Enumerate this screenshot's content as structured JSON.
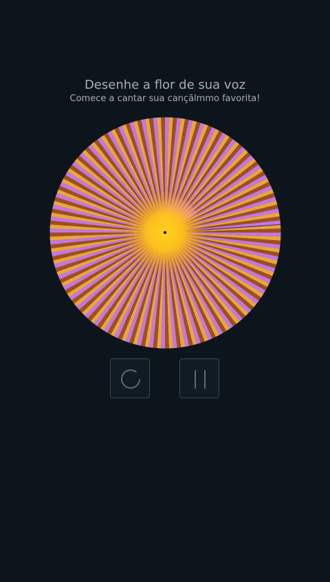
{
  "header": {
    "title": "Desenhe a flor de sua voz",
    "subtitle": "Comece a cantar sua cançãlmmo favorita!"
  },
  "flower": {
    "petal_count": 180,
    "colors": {
      "background": "#0c151c",
      "stripe_a": "#c276e6",
      "stripe_b": "#e9a63a",
      "stripe_c": "#9e4f1c",
      "core": "#ffd21a",
      "highlight": "#ff9cf2",
      "center_dot": "#111111"
    }
  },
  "controls": {
    "reset_icon": "circle-reset-icon",
    "pause_icon": "pause-icon",
    "border_color": "#3a4752"
  }
}
